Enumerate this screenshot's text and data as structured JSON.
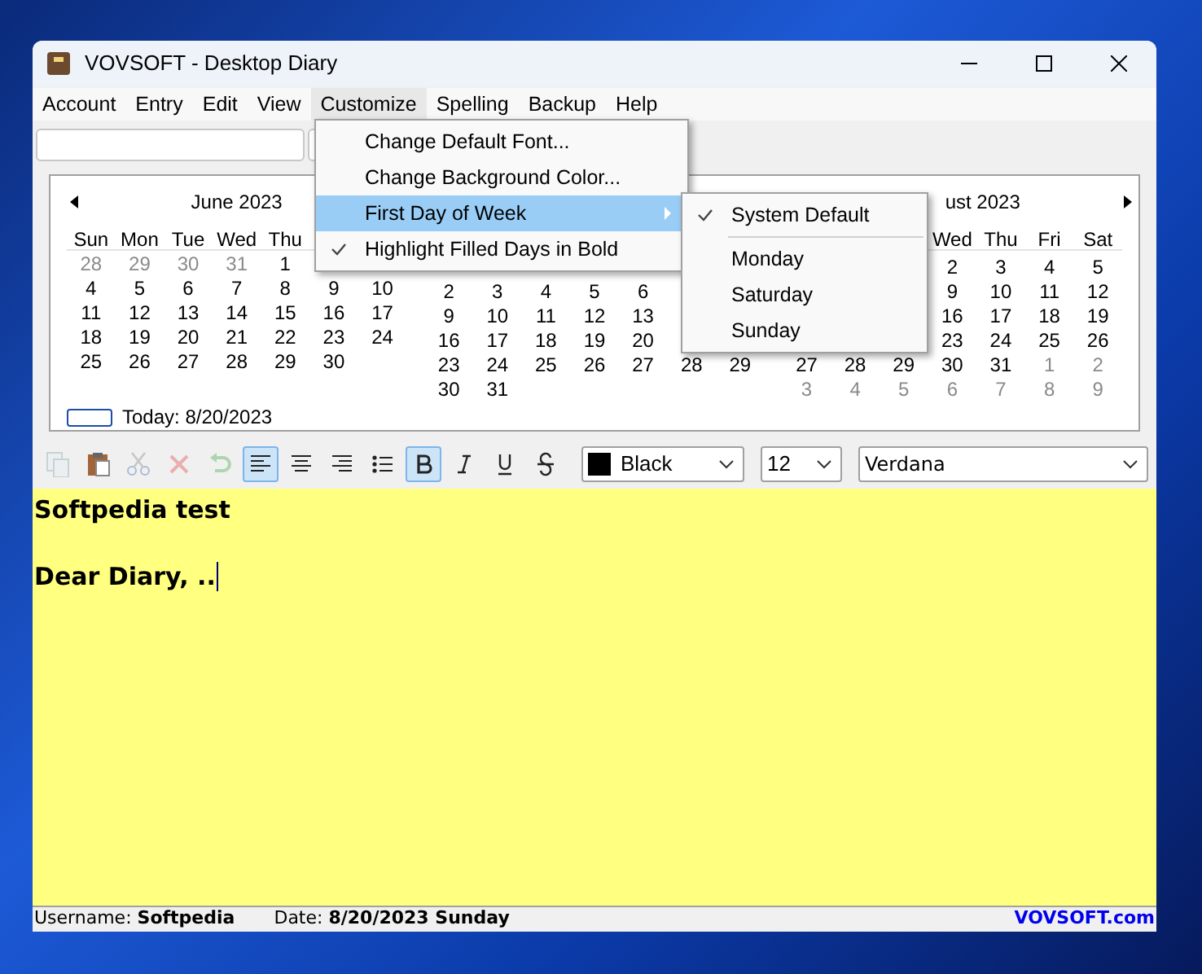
{
  "window": {
    "title": "VOVSOFT - Desktop Diary"
  },
  "menu_bar": [
    {
      "label": "Account",
      "selected": false
    },
    {
      "label": "Entry",
      "selected": false
    },
    {
      "label": "Edit",
      "selected": false
    },
    {
      "label": "View",
      "selected": false
    },
    {
      "label": "Customize",
      "selected": true
    },
    {
      "label": "Spelling",
      "selected": false
    },
    {
      "label": "Backup",
      "selected": false
    },
    {
      "label": "Help",
      "selected": false
    }
  ],
  "open_menu": [
    {
      "label": "Change Default Font...",
      "checked": false,
      "highlighted": false,
      "has_submenu": false
    },
    {
      "label": "Change Background Color...",
      "checked": false,
      "highlighted": false,
      "has_submenu": false
    },
    {
      "label": "First Day of Week",
      "checked": false,
      "highlighted": true,
      "has_submenu": true
    },
    {
      "label": "Highlight Filled Days in Bold",
      "checked": true,
      "highlighted": false,
      "has_submenu": false
    }
  ],
  "submenu": [
    {
      "kind": "option",
      "label": "System Default",
      "checked": true
    },
    {
      "kind": "separator"
    },
    {
      "kind": "option",
      "label": "Monday",
      "checked": false
    },
    {
      "kind": "option",
      "label": "Saturday",
      "checked": false
    },
    {
      "kind": "option",
      "label": "Sunday",
      "checked": false
    }
  ],
  "calendar": {
    "months": [
      {
        "title": "June 2023",
        "weekdays": [
          "Sun",
          "Mon",
          "Tue",
          "Wed",
          "Thu"
        ],
        "weeks": [
          [
            {
              "day": "28",
              "other_month": true
            },
            {
              "day": "29",
              "other_month": true
            },
            {
              "day": "30",
              "other_month": true
            },
            {
              "day": "31",
              "other_month": true
            },
            {
              "day": "1",
              "other_month": false
            }
          ],
          [
            {
              "day": "4",
              "other_month": false
            },
            {
              "day": "5",
              "other_month": false
            },
            {
              "day": "6",
              "other_month": false
            },
            {
              "day": "7",
              "other_month": false
            },
            {
              "day": "8",
              "other_month": false
            },
            {
              "day": "9",
              "other_month": false
            },
            {
              "day": "10",
              "other_month": false
            }
          ],
          [
            {
              "day": "11",
              "other_month": false
            },
            {
              "day": "12",
              "other_month": false
            },
            {
              "day": "13",
              "other_month": false
            },
            {
              "day": "14",
              "other_month": false
            },
            {
              "day": "15",
              "other_month": false
            },
            {
              "day": "16",
              "other_month": false
            },
            {
              "day": "17",
              "other_month": false
            }
          ],
          [
            {
              "day": "18",
              "other_month": false
            },
            {
              "day": "19",
              "other_month": false
            },
            {
              "day": "20",
              "other_month": false
            },
            {
              "day": "21",
              "other_month": false
            },
            {
              "day": "22",
              "other_month": false
            },
            {
              "day": "23",
              "other_month": false
            },
            {
              "day": "24",
              "other_month": false
            }
          ],
          [
            {
              "day": "25",
              "other_month": false
            },
            {
              "day": "26",
              "other_month": false
            },
            {
              "day": "27",
              "other_month": false
            },
            {
              "day": "28",
              "other_month": false
            },
            {
              "day": "29",
              "other_month": false
            },
            {
              "day": "30",
              "other_month": false
            }
          ]
        ]
      },
      {
        "weeks": [
          [
            {
              "day": "2",
              "other_month": false
            },
            {
              "day": "3",
              "other_month": false
            },
            {
              "day": "4",
              "other_month": false
            },
            {
              "day": "5",
              "other_month": false
            },
            {
              "day": "6",
              "other_month": false
            }
          ],
          [
            {
              "day": "9",
              "other_month": false
            },
            {
              "day": "10",
              "other_month": false
            },
            {
              "day": "11",
              "other_month": false
            },
            {
              "day": "12",
              "other_month": false
            },
            {
              "day": "13",
              "other_month": false
            }
          ],
          [
            {
              "day": "16",
              "other_month": false
            },
            {
              "day": "17",
              "other_month": false
            },
            {
              "day": "18",
              "other_month": false
            },
            {
              "day": "19",
              "other_month": false
            },
            {
              "day": "20",
              "other_month": false
            }
          ],
          [
            {
              "day": "23",
              "other_month": false
            },
            {
              "day": "24",
              "other_month": false
            },
            {
              "day": "25",
              "other_month": false
            },
            {
              "day": "26",
              "other_month": false
            },
            {
              "day": "27",
              "other_month": false
            },
            {
              "day": "28",
              "other_month": false
            },
            {
              "day": "29",
              "other_month": false
            }
          ],
          [
            {
              "day": "30",
              "other_month": false
            },
            {
              "day": "31",
              "other_month": false
            }
          ]
        ]
      },
      {
        "title": "ust 2023",
        "weekdays": [
          "Wed",
          "Thu",
          "Fri",
          "Sat"
        ],
        "weeks": [
          [
            {
              "day": "2",
              "other_month": false
            },
            {
              "day": "3",
              "other_month": false
            },
            {
              "day": "4",
              "other_month": false
            },
            {
              "day": "5",
              "other_month": false
            }
          ],
          [
            {
              "day": "9",
              "other_month": false
            },
            {
              "day": "10",
              "other_month": false
            },
            {
              "day": "11",
              "other_month": false
            },
            {
              "day": "12",
              "other_month": false
            }
          ],
          [
            {
              "day": "16",
              "other_month": false
            },
            {
              "day": "17",
              "other_month": false
            },
            {
              "day": "18",
              "other_month": false
            },
            {
              "day": "19",
              "other_month": false
            }
          ],
          [
            {
              "day": "23",
              "other_month": false
            },
            {
              "day": "24",
              "other_month": false
            },
            {
              "day": "25",
              "other_month": false
            },
            {
              "day": "26",
              "other_month": false
            }
          ],
          [
            {
              "day": "27",
              "other_month": false
            },
            {
              "day": "28",
              "other_month": false
            },
            {
              "day": "29",
              "other_month": false
            },
            {
              "day": "30",
              "other_month": false
            },
            {
              "day": "31",
              "other_month": false
            },
            {
              "day": "1",
              "other_month": true
            },
            {
              "day": "2",
              "other_month": true
            }
          ],
          [
            {
              "day": "3",
              "other_month": true
            },
            {
              "day": "4",
              "other_month": true
            },
            {
              "day": "5",
              "other_month": true
            },
            {
              "day": "6",
              "other_month": true
            },
            {
              "day": "7",
              "other_month": true
            },
            {
              "day": "8",
              "other_month": true
            },
            {
              "day": "9",
              "other_month": true
            }
          ]
        ]
      }
    ],
    "today": "Today: 8/20/2023"
  },
  "format_toolbar": {
    "buttons": [
      {
        "kind": "copy",
        "disabled": true,
        "selected": false
      },
      {
        "kind": "paste",
        "disabled": false,
        "selected": false
      },
      {
        "kind": "cut",
        "disabled": true,
        "selected": false
      },
      {
        "kind": "delete",
        "disabled": true,
        "selected": false
      },
      {
        "kind": "undo",
        "disabled": true,
        "selected": false
      },
      {
        "kind": "align_left",
        "disabled": false,
        "selected": true
      },
      {
        "kind": "align_center",
        "disabled": false,
        "selected": false
      },
      {
        "kind": "align_right",
        "disabled": false,
        "selected": false
      },
      {
        "kind": "bullets",
        "disabled": false,
        "selected": false
      },
      {
        "kind": "bold",
        "disabled": false,
        "selected": true
      },
      {
        "kind": "italic",
        "disabled": false,
        "selected": false
      },
      {
        "kind": "underline",
        "disabled": false,
        "selected": false
      },
      {
        "kind": "strike",
        "disabled": false,
        "selected": false
      }
    ],
    "color": {
      "color": "#000000",
      "value": "Black"
    },
    "size": "12",
    "font": "Verdana"
  },
  "editor": {
    "paragraphs": [
      "Softpedia test",
      "Dear Diary, .."
    ]
  },
  "status_bar": {
    "username": "Username: **Softpedia**",
    "date": "Date: **8/20/2023 Sunday**",
    "link": "VOVSOFT.com"
  }
}
